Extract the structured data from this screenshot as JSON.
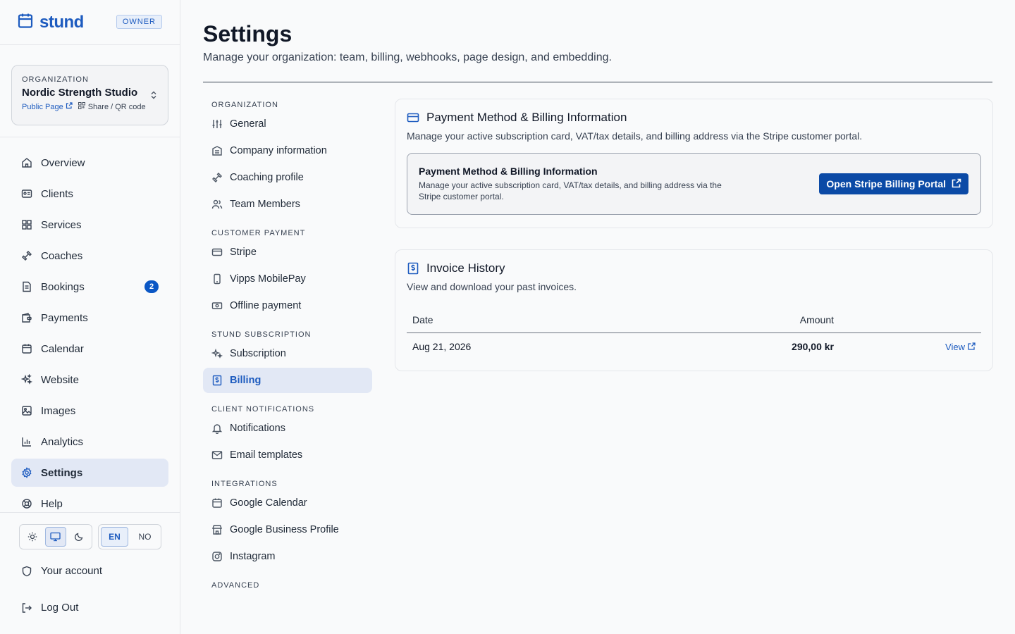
{
  "brand": {
    "name": "stund",
    "role_badge": "OWNER"
  },
  "org": {
    "label": "ORGANIZATION",
    "name": "Nordic Strength Studio",
    "public_page": "Public Page",
    "share": "Share / QR code"
  },
  "nav": {
    "items": [
      {
        "label": "Overview",
        "icon": "home-icon"
      },
      {
        "label": "Clients",
        "icon": "id-card-icon"
      },
      {
        "label": "Services",
        "icon": "grid-icon"
      },
      {
        "label": "Coaches",
        "icon": "dumbbell-icon"
      },
      {
        "label": "Bookings",
        "icon": "document-icon",
        "badge": "2"
      },
      {
        "label": "Payments",
        "icon": "wallet-icon"
      },
      {
        "label": "Calendar",
        "icon": "calendar-icon"
      },
      {
        "label": "Website",
        "icon": "sparkles-icon"
      },
      {
        "label": "Images",
        "icon": "image-icon"
      },
      {
        "label": "Analytics",
        "icon": "bar-chart-icon"
      },
      {
        "label": "Settings",
        "icon": "gear-icon",
        "active": true
      },
      {
        "label": "Help",
        "icon": "lifebuoy-icon"
      }
    ]
  },
  "controls": {
    "theme_options": [
      "light",
      "system",
      "dark"
    ],
    "theme_selected": "system",
    "lang": [
      "EN",
      "NO"
    ],
    "lang_selected": "EN"
  },
  "account": {
    "your_account": "Your account",
    "logout": "Log Out"
  },
  "page": {
    "title": "Settings",
    "subtitle": "Manage your organization: team, billing, webhooks, page design, and embedding."
  },
  "subnav": {
    "org_section": "ORGANIZATION",
    "general": "General",
    "company": "Company information",
    "coaching": "Coaching profile",
    "team": "Team Members",
    "payment_section": "CUSTOMER PAYMENT",
    "stripe": "Stripe",
    "vipps": "Vipps MobilePay",
    "offline": "Offline payment",
    "subscription_section": "STUND SUBSCRIPTION",
    "subscription": "Subscription",
    "billing": "Billing",
    "notifications_section": "CLIENT NOTIFICATIONS",
    "notifications": "Notifications",
    "email_templates": "Email templates",
    "integrations_section": "INTEGRATIONS",
    "google_calendar": "Google Calendar",
    "google_business": "Google Business Profile",
    "instagram": "Instagram",
    "advanced_section": "ADVANCED"
  },
  "billing_card": {
    "title": "Payment Method & Billing Information",
    "desc": "Manage your active subscription card, VAT/tax details, and billing address via the Stripe customer portal.",
    "inner_title": "Payment Method & Billing Information",
    "inner_desc": "Manage your active subscription card, VAT/tax details, and billing address via the Stripe customer portal.",
    "button": "Open Stripe Billing Portal"
  },
  "invoice_card": {
    "title": "Invoice History",
    "desc": "View and download your past invoices.",
    "columns": {
      "date": "Date",
      "amount": "Amount"
    },
    "rows": [
      {
        "date": "Aug 21, 2026",
        "amount": "290,00 kr",
        "action": "View"
      }
    ]
  },
  "colors": {
    "accent": "#1d5bbf",
    "button": "#0b4aa6",
    "badge": "#0b57c5"
  }
}
